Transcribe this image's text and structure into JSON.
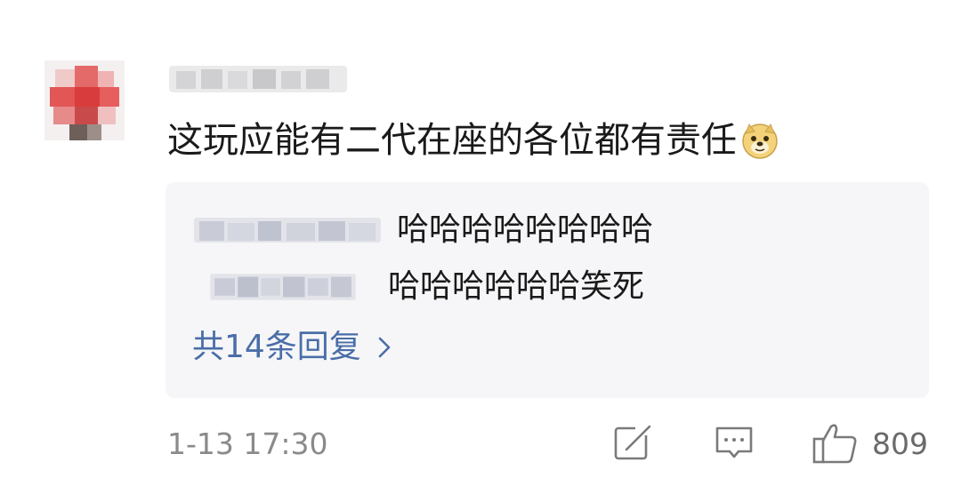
{
  "comment": {
    "text": "这玩应能有二代在座的各位都有责任",
    "emoji_icon": "doge-emoji-icon"
  },
  "replies": [
    {
      "text": "哈哈哈哈哈哈哈哈"
    },
    {
      "text": "哈哈哈哈哈哈笑死"
    }
  ],
  "more_replies_label": "共14条回复",
  "footer": {
    "time": "1-13 17:30",
    "like_count": "809"
  },
  "colors": {
    "link": "#4a6ea8",
    "reply_bg": "#f6f6f8",
    "meta_text": "#8a8a8a"
  }
}
